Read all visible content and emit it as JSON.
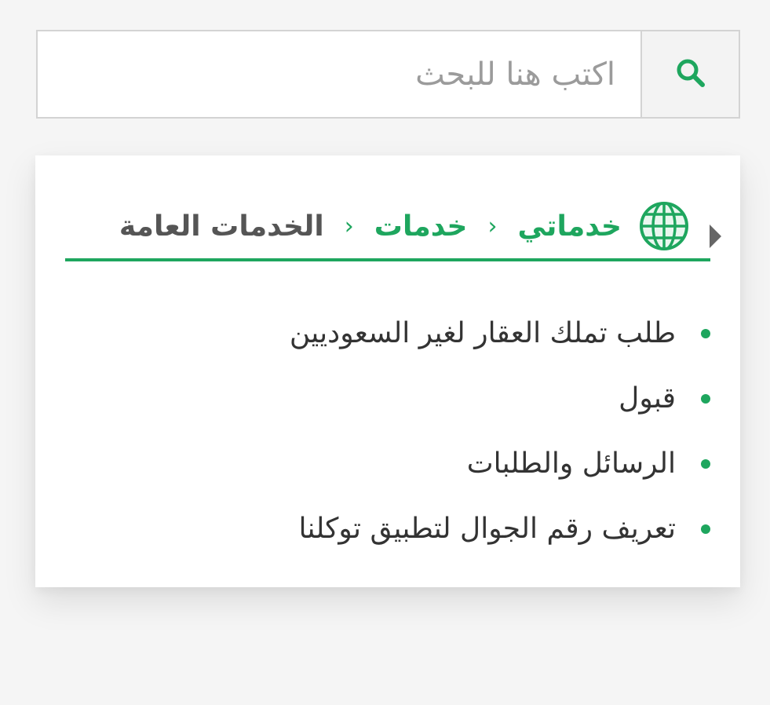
{
  "colors": {
    "accent": "#1ea65e",
    "breadcrumb_current": "#555555",
    "text": "#333333",
    "placeholder": "#9b9b9b"
  },
  "search": {
    "placeholder": "اكتب هنا للبحث",
    "value": "",
    "button_icon": "search-icon"
  },
  "breadcrumb": {
    "icon": "globe-icon",
    "items": [
      {
        "label": "خدماتي",
        "link": true
      },
      {
        "label": "خدمات",
        "link": true
      },
      {
        "label": "الخدمات العامة",
        "link": false
      }
    ],
    "separator_icon": "chevron-left-icon",
    "toggle_icon": "caret-right-icon"
  },
  "services": [
    "طلب تملك العقار لغير السعوديين",
    "قبول",
    "الرسائل والطلبات",
    "تعريف رقم الجوال لتطبيق توكلنا"
  ]
}
